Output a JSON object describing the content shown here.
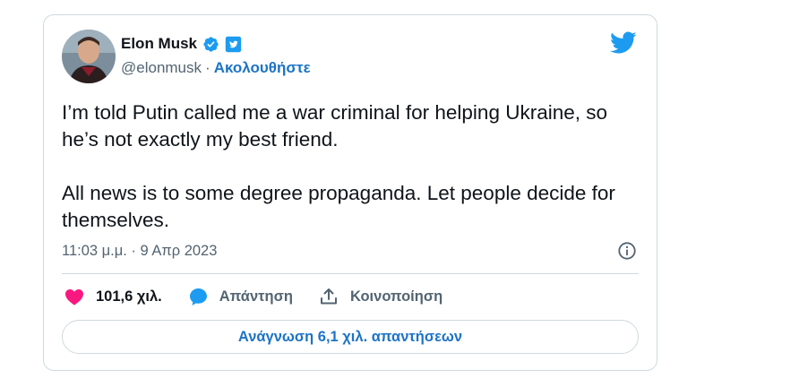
{
  "author": {
    "name": "Elon Musk",
    "handle": "@elonmusk",
    "separator": "·",
    "follow_label": "Ακολουθήστε"
  },
  "tweet": {
    "paragraphs": [
      "I’m told Putin called me a war criminal for helping Ukraine, so he’s not exactly my best friend.",
      "All news is to some degree propaganda. Let people decide for themselves."
    ],
    "timestamp": "11:03 μ.μ. · 9 Απρ 2023"
  },
  "actions": {
    "likes": "101,6 χιλ.",
    "reply": "Απάντηση",
    "share": "Κοινοποίηση"
  },
  "read_replies": "Ανάγνωση 6,1 χιλ. απαντήσεων",
  "colors": {
    "accent": "#1d9bf0",
    "link": "#1d74c6",
    "like": "#f91880",
    "muted": "#536471",
    "border": "#cfd9de"
  },
  "icons": [
    "verified-badge-icon",
    "twitter-badge-icon",
    "twitter-bird-icon",
    "info-icon",
    "heart-icon",
    "reply-bubble-icon",
    "share-icon"
  ]
}
